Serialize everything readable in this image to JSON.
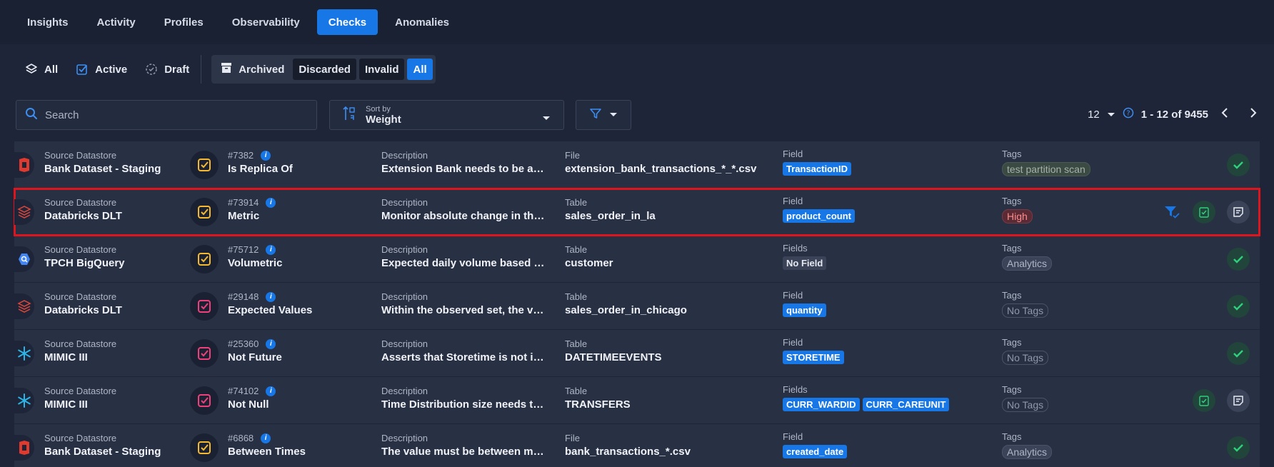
{
  "nav": {
    "tabs": [
      "Insights",
      "Activity",
      "Profiles",
      "Observability",
      "Checks",
      "Anomalies"
    ],
    "active": 4
  },
  "status_filters": {
    "all": "All",
    "active": "Active",
    "draft": "Draft"
  },
  "archive_filters": {
    "archived": "Archived",
    "discarded": "Discarded",
    "invalid": "Invalid",
    "all": "All"
  },
  "search": {
    "placeholder": "Search"
  },
  "sort": {
    "label": "Sort by",
    "value": "Weight"
  },
  "pager": {
    "page_size": "12",
    "range": "1 - 12 of 9455"
  },
  "colors": {
    "accent": "#1877e6",
    "highlight": "#e0141d",
    "bg": "#1e2538",
    "row": "#283044"
  },
  "rows": [
    {
      "ds_label": "Source Datastore",
      "ds_name": "Bank Dataset - Staging",
      "ds_icon": "bank-icon",
      "check_icon": "yellow",
      "id": "#7382",
      "check": "Is Replica Of",
      "desc_label": "Description",
      "desc": "Extension Bank needs to be a repli...",
      "target_label": "File",
      "target": "extension_bank_transactions_*_*.csv",
      "field_label": "Field",
      "fields": [
        "TransactionID"
      ],
      "tags_label": "Tags",
      "tag": "test partition scan",
      "tag_style": "testp"
    },
    {
      "ds_label": "Source Datastore",
      "ds_name": "Databricks DLT",
      "ds_icon": "databricks-icon",
      "check_icon": "yellow",
      "id": "#73914",
      "check": "Metric",
      "desc_label": "Description",
      "desc": "Monitor absolute change in the m...",
      "target_label": "Table",
      "target": "sales_order_in_la",
      "field_label": "Field",
      "fields": [
        "product_count"
      ],
      "tags_label": "Tags",
      "tag": "High",
      "tag_style": "high"
    },
    {
      "ds_label": "Source Datastore",
      "ds_name": "TPCH BigQuery",
      "ds_icon": "bigquery-icon",
      "check_icon": "yellow",
      "id": "#75712",
      "check": "Volumetric",
      "desc_label": "Description",
      "desc": "Expected daily volume based upo...",
      "target_label": "Table",
      "target": "customer",
      "field_label": "Fields",
      "fields": [
        "No Field"
      ],
      "tags_label": "Tags",
      "tag": "Analytics",
      "tag_style": "analytics"
    },
    {
      "ds_label": "Source Datastore",
      "ds_name": "Databricks DLT",
      "ds_icon": "databricks-icon",
      "check_icon": "pink",
      "id": "#29148",
      "check": "Expected Values",
      "desc_label": "Description",
      "desc": "Within the observed set, the valu...",
      "target_label": "Table",
      "target": "sales_order_in_chicago",
      "field_label": "Field",
      "fields": [
        "quantity"
      ],
      "tags_label": "Tags",
      "tag": "No Tags",
      "tag_style": "none"
    },
    {
      "ds_label": "Source Datastore",
      "ds_name": "MIMIC III",
      "ds_icon": "snowflake-icon",
      "check_icon": "pink",
      "id": "#25360",
      "check": "Not Future",
      "desc_label": "Description",
      "desc": "Asserts that Storetime is not in fu...",
      "target_label": "Table",
      "target": "DATETIMEEVENTS",
      "field_label": "Field",
      "fields": [
        "STORETIME"
      ],
      "tags_label": "Tags",
      "tag": "No Tags",
      "tag_style": "none"
    },
    {
      "ds_label": "Source Datastore",
      "ds_name": "MIMIC III",
      "ds_icon": "snowflake-icon",
      "check_icon": "pink",
      "id": "#74102",
      "check": "Not Null",
      "desc_label": "Description",
      "desc": "Time Distribution size needs to be...",
      "target_label": "Table",
      "target": "TRANSFERS",
      "field_label": "Fields",
      "fields": [
        "CURR_WARDID",
        "CURR_CAREUNIT"
      ],
      "tags_label": "Tags",
      "tag": "No Tags",
      "tag_style": "none"
    },
    {
      "ds_label": "Source Datastore",
      "ds_name": "Bank Dataset - Staging",
      "ds_icon": "bank-icon",
      "check_icon": "yellow",
      "id": "#6868",
      "check": "Between Times",
      "desc_label": "Description",
      "desc": "The value must be between minTi...",
      "target_label": "File",
      "target": "bank_transactions_*.csv",
      "field_label": "Field",
      "fields": [
        "created_date"
      ],
      "tags_label": "Tags",
      "tag": "Analytics",
      "tag_style": "analytics"
    }
  ]
}
